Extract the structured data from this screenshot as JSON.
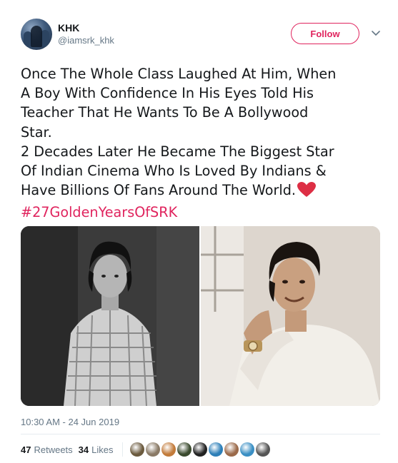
{
  "author": {
    "display_name": "KHK",
    "handle": "@iamsrk_khk",
    "avatar_icon": "profile-avatar"
  },
  "actions": {
    "follow_label": "Follow",
    "menu_icon": "chevron-down-icon"
  },
  "tweet": {
    "lines": [
      "Once The Whole Class Laughed At Him, When",
      "A Boy With Confidence In His Eyes Told His",
      "Teacher That He Wants To Be A Bollywood",
      "Star.",
      "2 Decades Later He Became The Biggest Star",
      "Of Indian Cinema Who Is Loved By Indians &",
      "Have Billions Of Fans Around The World."
    ],
    "emoji": "heart-icon",
    "hashtag": "#27GoldenYearsOfSRK"
  },
  "media": {
    "left": "black-and-white photo of a young boy in a checked shirt",
    "right": "color photo of a smiling man with a wristwatch"
  },
  "timestamp": "10:30 AM - 24 Jun 2019",
  "stats": {
    "retweets_count": "47",
    "retweets_label": "Retweets",
    "likes_count": "34",
    "likes_label": "Likes"
  },
  "likers": [
    {
      "color": "#6b5a3e"
    },
    {
      "color": "#8a7a66"
    },
    {
      "color": "#c27b3a"
    },
    {
      "color": "#3a4a2e"
    },
    {
      "color": "#222222"
    },
    {
      "color": "#2d7fb8"
    },
    {
      "color": "#9b6a4a"
    },
    {
      "color": "#3a8fc4"
    },
    {
      "color": "#555555"
    }
  ],
  "colors": {
    "accent": "#e0245e",
    "secondary_text": "#657786",
    "primary_text": "#14171a"
  }
}
